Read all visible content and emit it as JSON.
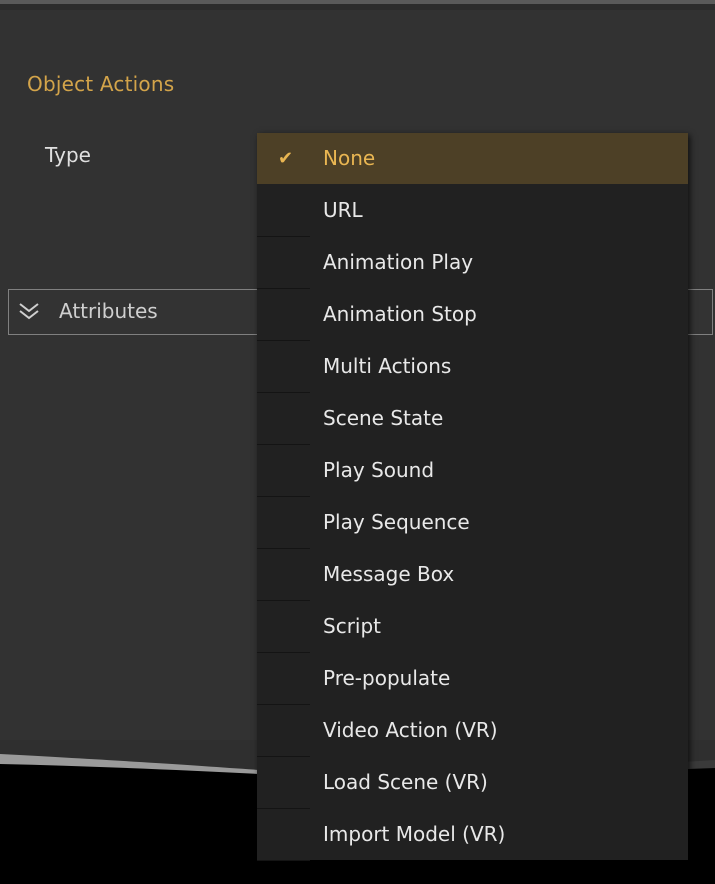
{
  "panel": {
    "section_title": "Object Actions",
    "type_label": "Type",
    "attributes_label": "Attributes"
  },
  "dropdown": {
    "selected_index": 0,
    "items": [
      {
        "label": "None",
        "selected": true
      },
      {
        "label": "URL"
      },
      {
        "label": "Animation Play"
      },
      {
        "label": "Animation Stop"
      },
      {
        "label": "Multi Actions"
      },
      {
        "label": "Scene State"
      },
      {
        "label": "Play Sound"
      },
      {
        "label": "Play Sequence"
      },
      {
        "label": "Message Box"
      },
      {
        "label": "Script"
      },
      {
        "label": "Pre-populate"
      },
      {
        "label": "Video Action (VR)"
      },
      {
        "label": "Load Scene (VR)"
      },
      {
        "label": "Import Model (VR)"
      }
    ]
  },
  "colors": {
    "accent": "#d3a44a",
    "selected_bg": "#4d4026",
    "menu_bg": "#212121",
    "panel_bg": "#323232"
  },
  "icons": {
    "check": "check-icon",
    "expand": "double-chevron-down-icon"
  }
}
